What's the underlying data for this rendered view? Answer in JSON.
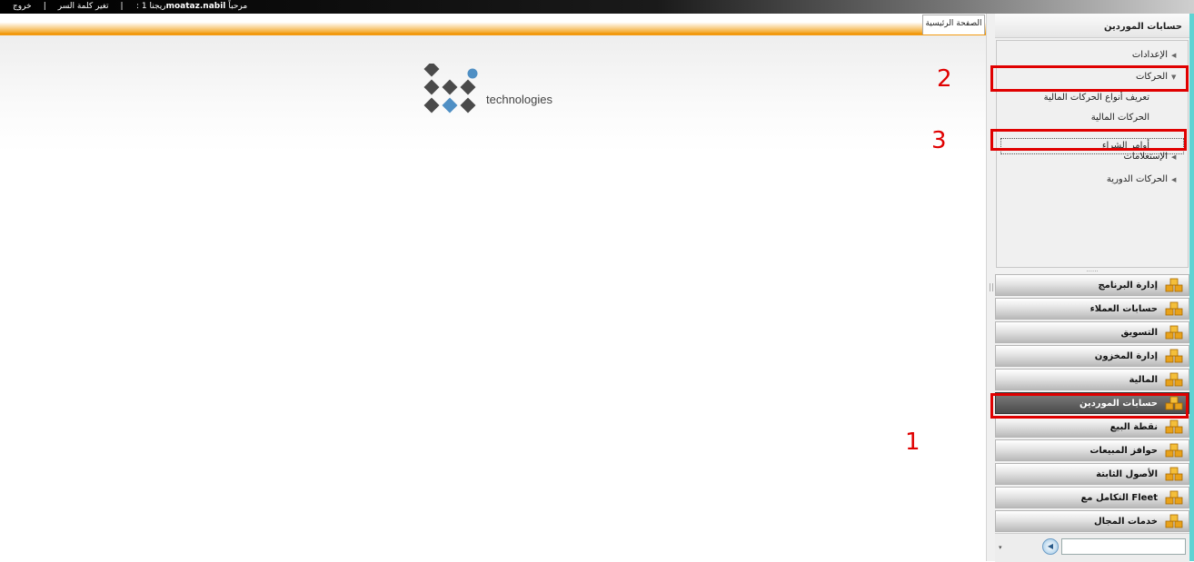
{
  "topbar": {
    "logout": "خروج",
    "change_password": "تغير كلمة السر",
    "separator": "|",
    "welcome_label": "مرحباً",
    "user": "moataz.nabil",
    "branch": ": ريجنا 1"
  },
  "content": {
    "tab_home": "الصفحة الرئيسية",
    "logo_text": "technologies"
  },
  "sidebar": {
    "header": "حسابات الموردين",
    "tree": [
      {
        "label": "الإعدادات",
        "expanded": false
      },
      {
        "label": "الحركات",
        "expanded": true
      },
      {
        "label": "الإستعلامات",
        "expanded": false
      },
      {
        "label": "الحركات الدورية",
        "expanded": false
      }
    ],
    "tree_children": [
      "تعريف أنواع الحركات المالية",
      "الحركات المالية",
      "أوامر الشراء"
    ],
    "modules": [
      "إدارة البرنامج",
      "حسابات العملاء",
      "التسويق",
      "إدارة المخزون",
      "المالية",
      "حسابات الموردين",
      "نقطة البيع",
      "حوافز المبيعات",
      "الأصول الثابتة",
      "التكامل مع Fleet",
      "خدمات المجال"
    ],
    "active_module": "حسابات الموردين"
  },
  "annotations": {
    "n1": "1",
    "n2": "2",
    "n3": "3"
  },
  "colors": {
    "annotation": "#e00000",
    "accent_orange": "#f29a10",
    "teal_edge": "#5fd3d3"
  }
}
